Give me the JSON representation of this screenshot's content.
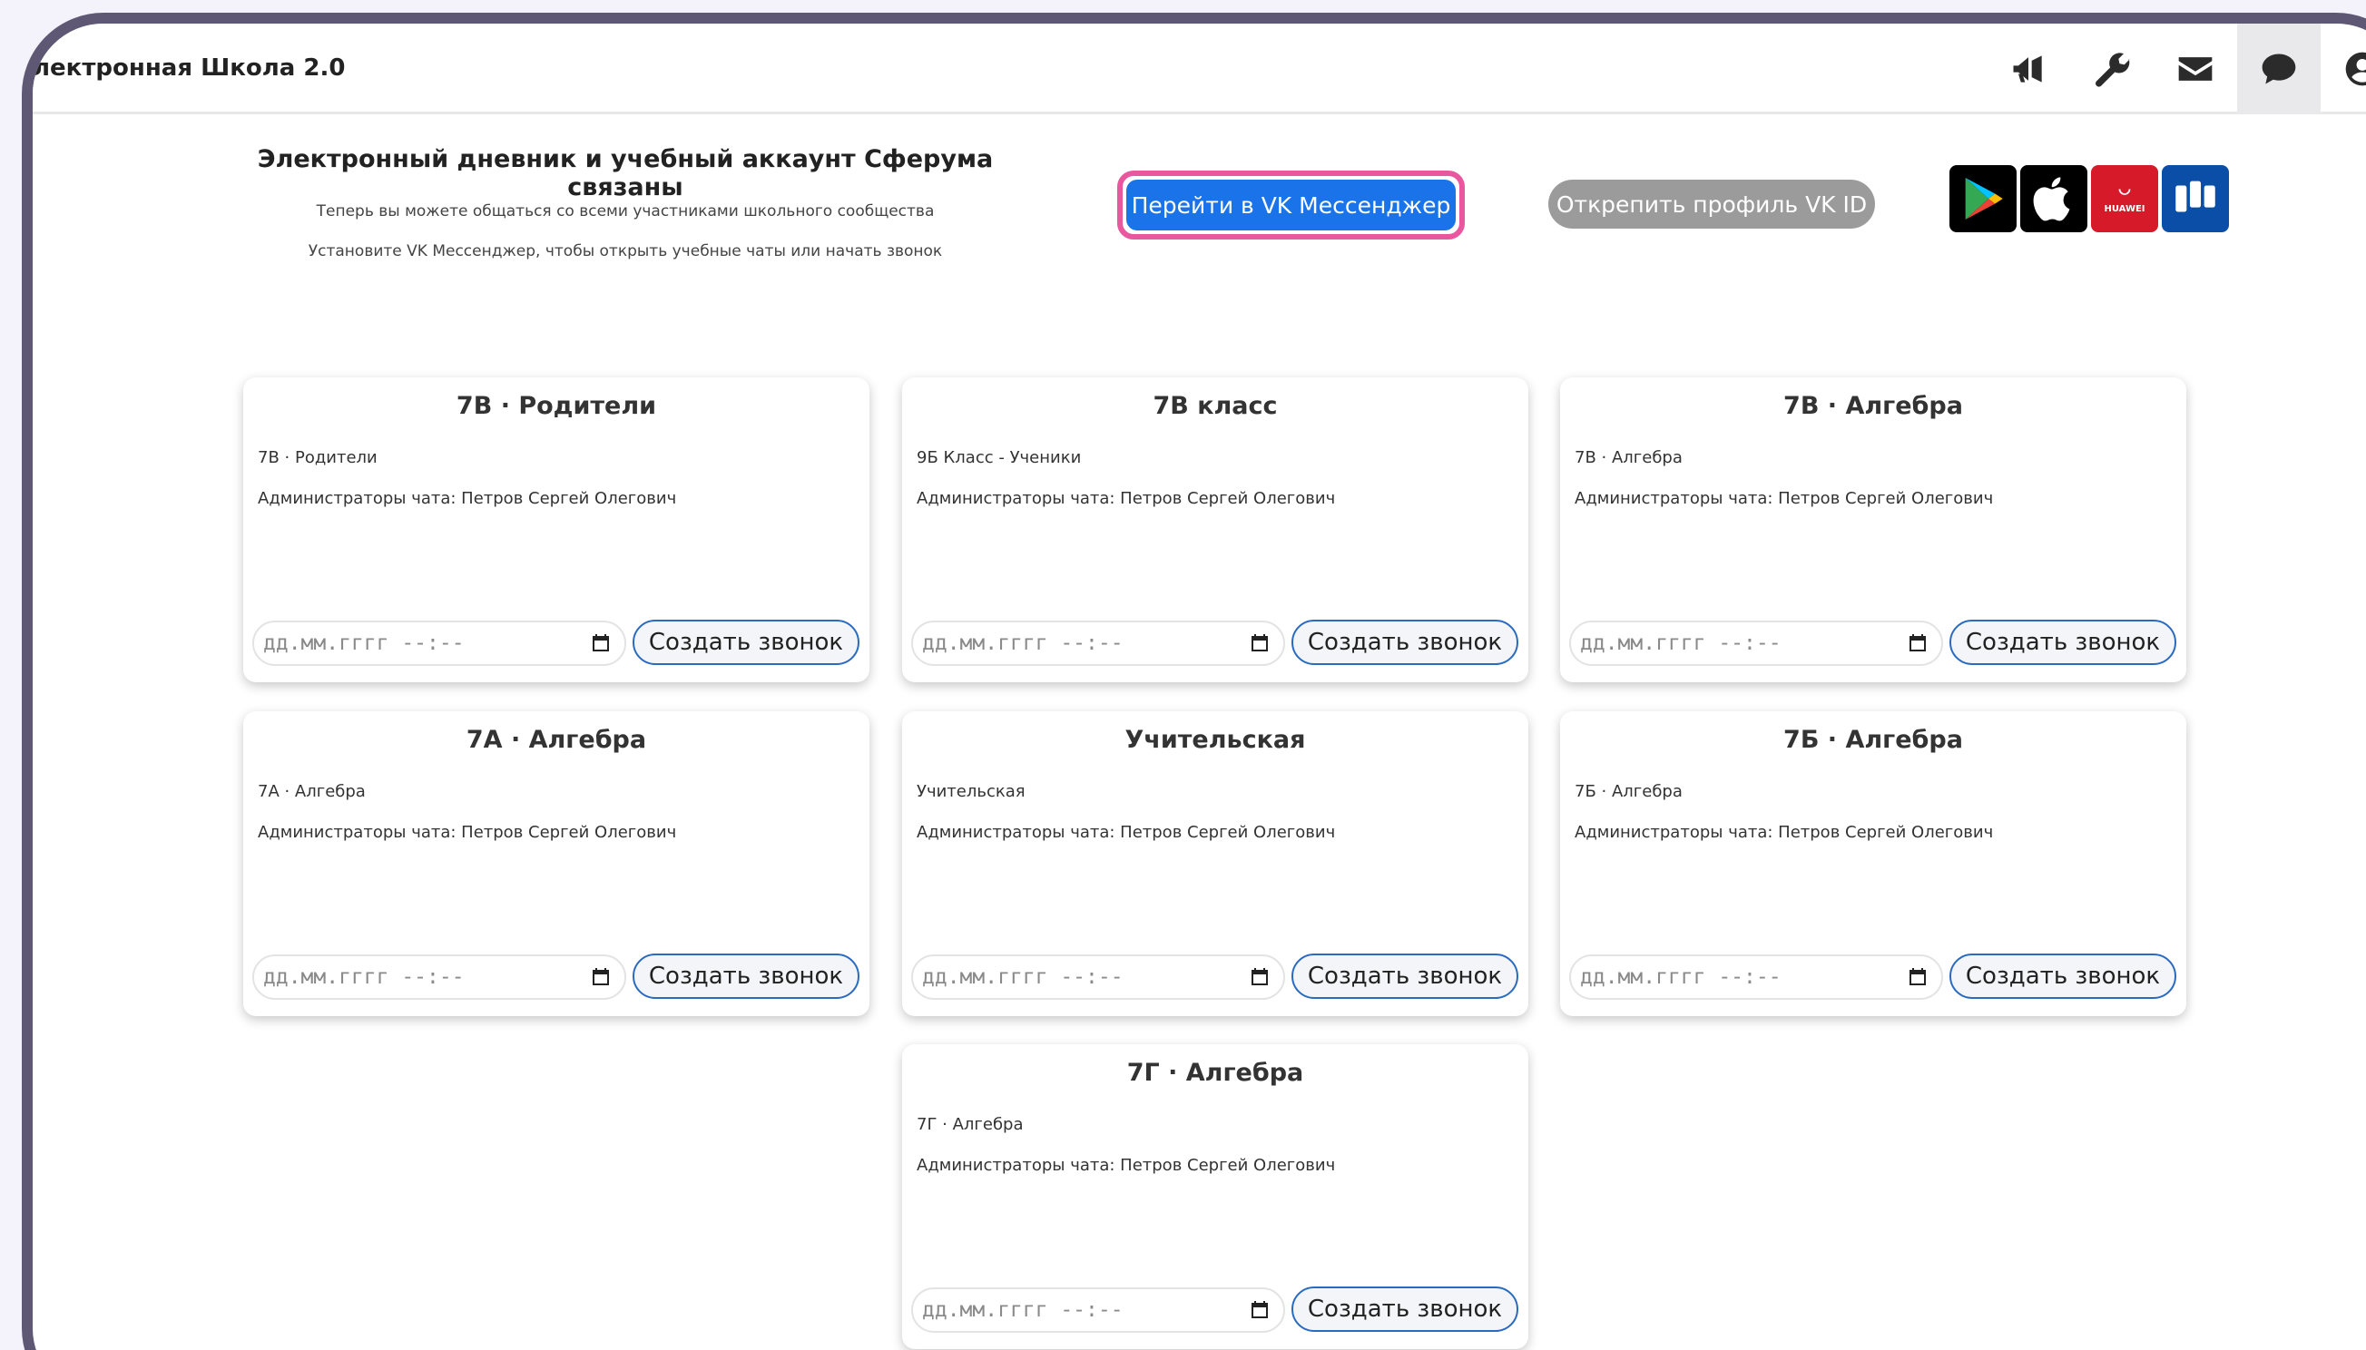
{
  "app": {
    "title": "лектронная Школа 2.0"
  },
  "topbar": {
    "icons": [
      "megaphone-icon",
      "wrench-icon",
      "envelope-icon",
      "chat-icon",
      "user-circle-icon"
    ]
  },
  "banner": {
    "title": "Электронный дневник и учебный аккаунт Сферума связаны",
    "line1": "Теперь вы можете общаться со всеми участниками школьного сообщества",
    "line2": "Установите VK Мессенджер, чтобы открыть учебные чаты или начать звонок",
    "vk_button": "Перейти в VK Мессенджер",
    "unpin_button": "Открепить профиль VK ID",
    "stores": [
      "google-play-icon",
      "apple-app-store-icon",
      "huawei-appgallery-icon",
      "rustore-icon"
    ],
    "huawei_text": "HUAWEI"
  },
  "cards": [
    {
      "title": "7В · Родители",
      "subtitle": "7В · Родители",
      "admins": "Администраторы чата: Петров Сергей Олегович",
      "date_placeholder": "дд.мм.гггг --:--",
      "button": "Создать звонок"
    },
    {
      "title": "7В класс",
      "subtitle": "9Б Класс - Ученики",
      "admins": "Администраторы чата: Петров Сергей Олегович",
      "date_placeholder": "дд.мм.гггг --:--",
      "button": "Создать звонок"
    },
    {
      "title": "7В · Алгебра",
      "subtitle": "7В · Алгебра",
      "admins": "Администраторы чата: Петров Сергей Олегович",
      "date_placeholder": "дд.мм.гггг --:--",
      "button": "Создать звонок"
    },
    {
      "title": "7А · Алгебра",
      "subtitle": "7А · Алгебра",
      "admins": "Администраторы чата: Петров Сергей Олегович",
      "date_placeholder": "дд.мм.гггг --:--",
      "button": "Создать звонок"
    },
    {
      "title": "Учительская",
      "subtitle": "Учительская",
      "admins": "Администраторы чата: Петров Сергей Олегович",
      "date_placeholder": "дд.мм.гггг --:--",
      "button": "Создать звонок"
    },
    {
      "title": "7Б · Алгебра",
      "subtitle": "7Б · Алгебра",
      "admins": "Администраторы чата: Петров Сергей Олегович",
      "date_placeholder": "дд.мм.гггг --:--",
      "button": "Создать звонок"
    },
    {
      "title": "7Г · Алгебра",
      "subtitle": "7Г · Алгебра",
      "admins": "Администраторы чата: Петров Сергей Олегович",
      "date_placeholder": "дд.мм.гггг --:--",
      "button": "Создать звонок"
    }
  ],
  "colors": {
    "frame": "#5e5874",
    "vk_blue": "#1a73e8",
    "highlight_pink": "#e9579f",
    "unpin_gray": "#9b9b9b",
    "call_border": "#2b6bbf"
  }
}
